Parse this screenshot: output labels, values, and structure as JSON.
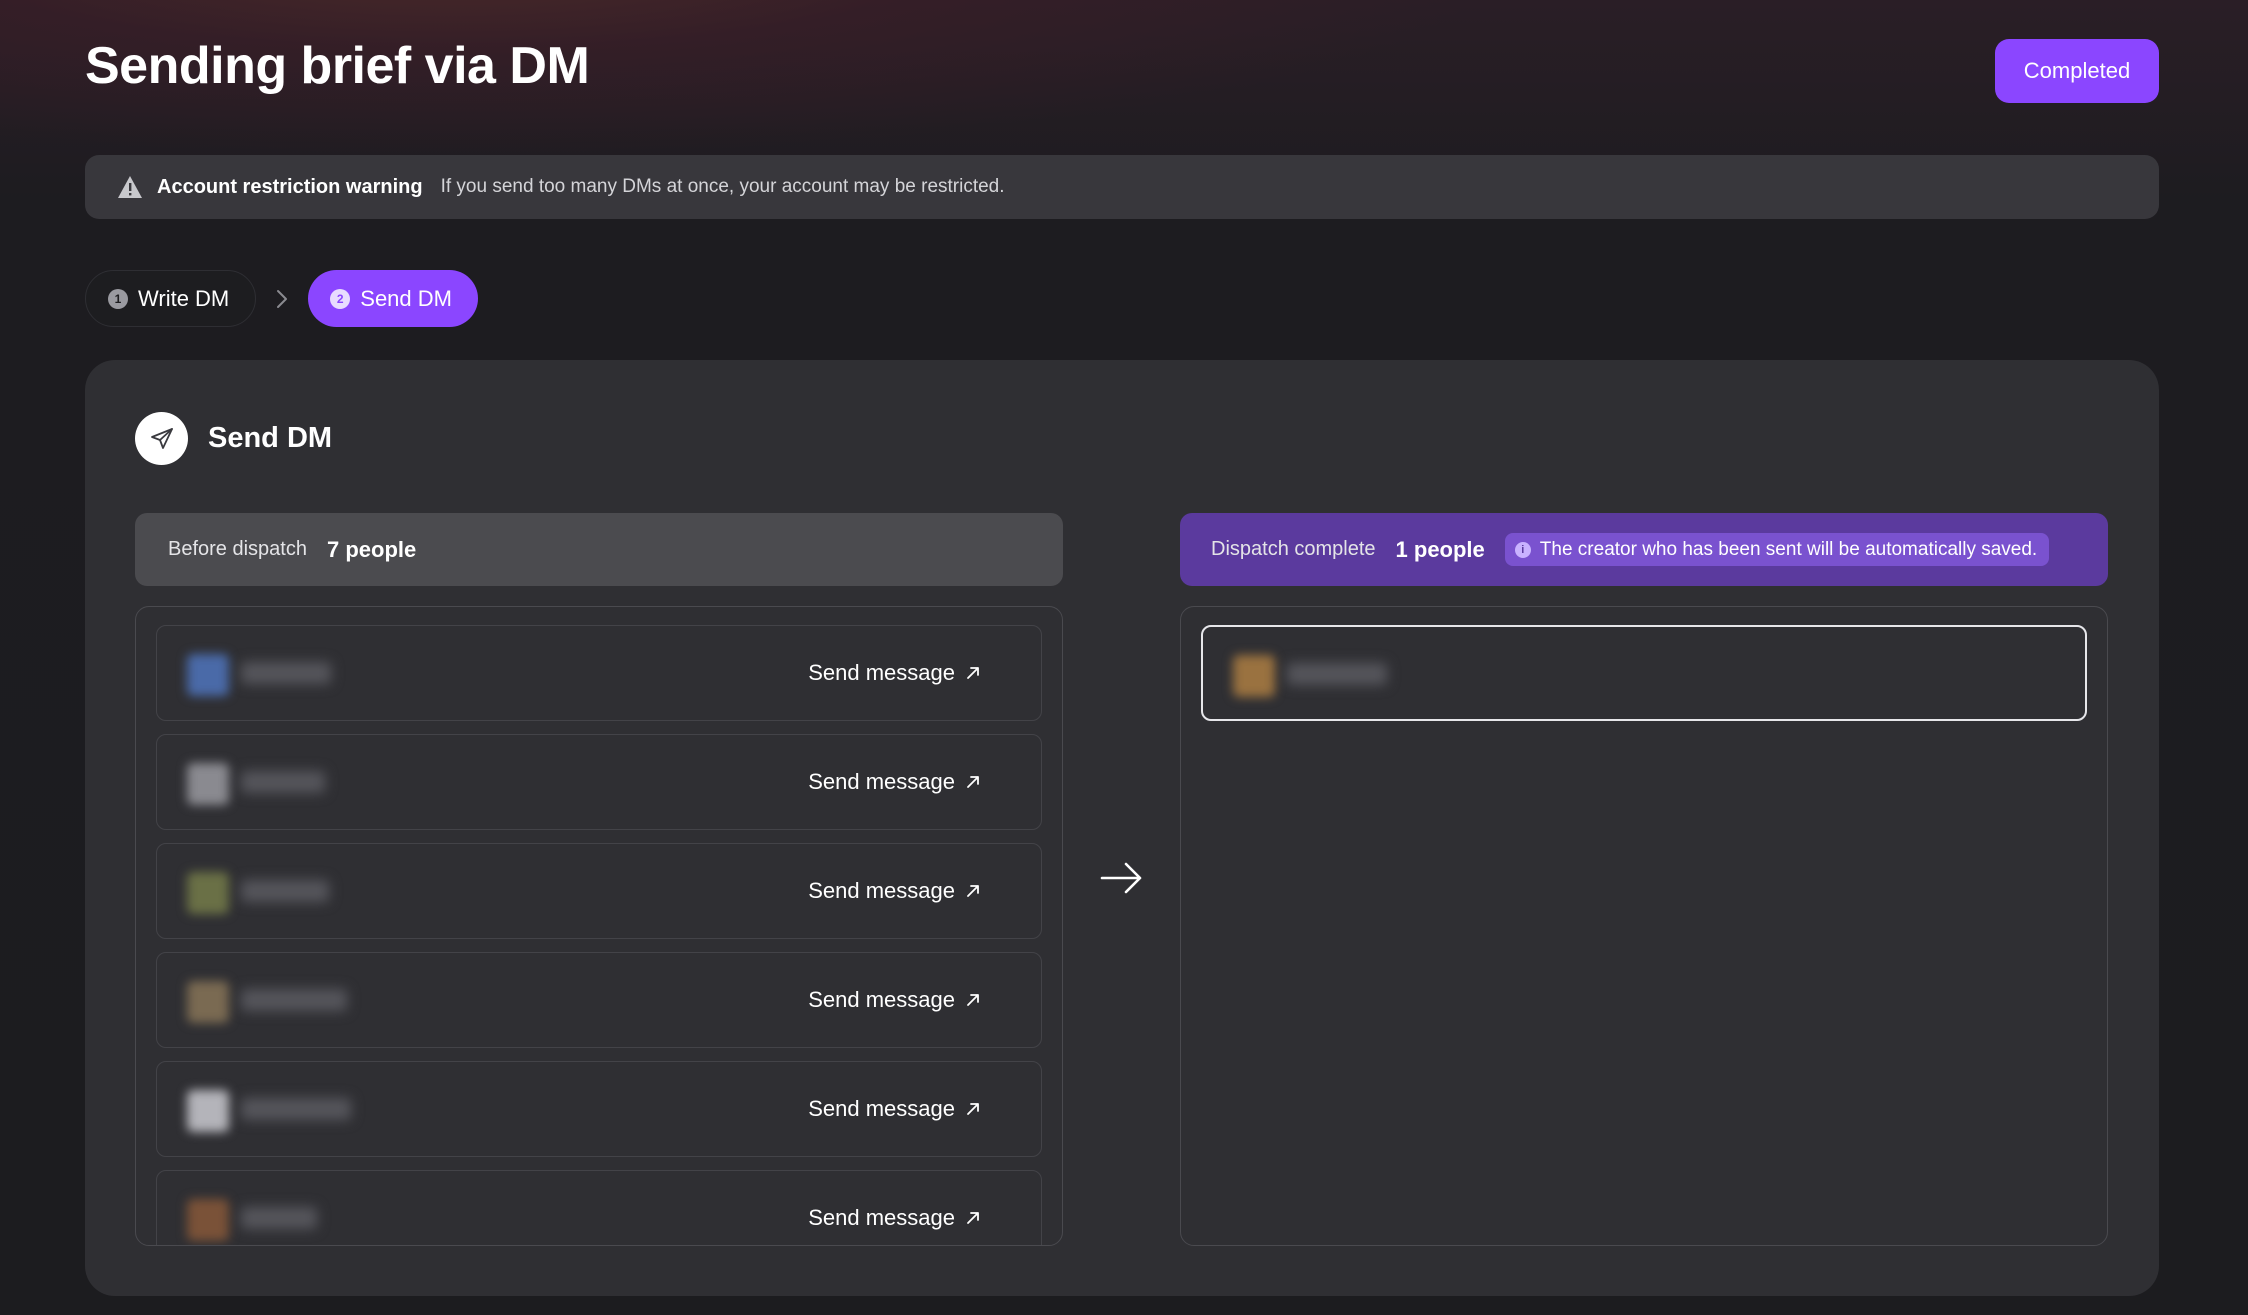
{
  "page": {
    "title": "Sending brief via DM",
    "completed_label": "Completed"
  },
  "warning": {
    "icon": "warning-triangle-icon",
    "title": "Account restriction warning",
    "text": "If you send too many DMs at once, your account may be restricted."
  },
  "stepper": {
    "steps": [
      {
        "num": "1",
        "label": "Write DM",
        "active": false
      },
      {
        "num": "2",
        "label": "Send DM",
        "active": true
      }
    ]
  },
  "card": {
    "title": "Send DM",
    "icon": "paper-plane-icon"
  },
  "before": {
    "label": "Before dispatch",
    "count": "7 people"
  },
  "after": {
    "label": "Dispatch complete",
    "count": "1 people",
    "info_icon": "info-icon",
    "info": "The creator who has been sent will be automatically saved."
  },
  "pending_rows": [
    {
      "action": "Send message",
      "avatar_color": "#4a6aa8"
    },
    {
      "action": "Send message",
      "avatar_color": "#8a8a90"
    },
    {
      "action": "Send message",
      "avatar_color": "#6a7046"
    },
    {
      "action": "Send message",
      "avatar_color": "#7a6a52"
    },
    {
      "action": "Send message",
      "avatar_color": "#b4b4ba"
    },
    {
      "action": "Send message",
      "avatar_color": "#7a5238"
    }
  ],
  "sent_rows": [
    {
      "avatar_color": "#9a7240"
    }
  ],
  "colors": {
    "accent": "#8b46ff",
    "card_bg": "#2f2f33",
    "dispatch_complete_bg": "#5b3a9e"
  }
}
